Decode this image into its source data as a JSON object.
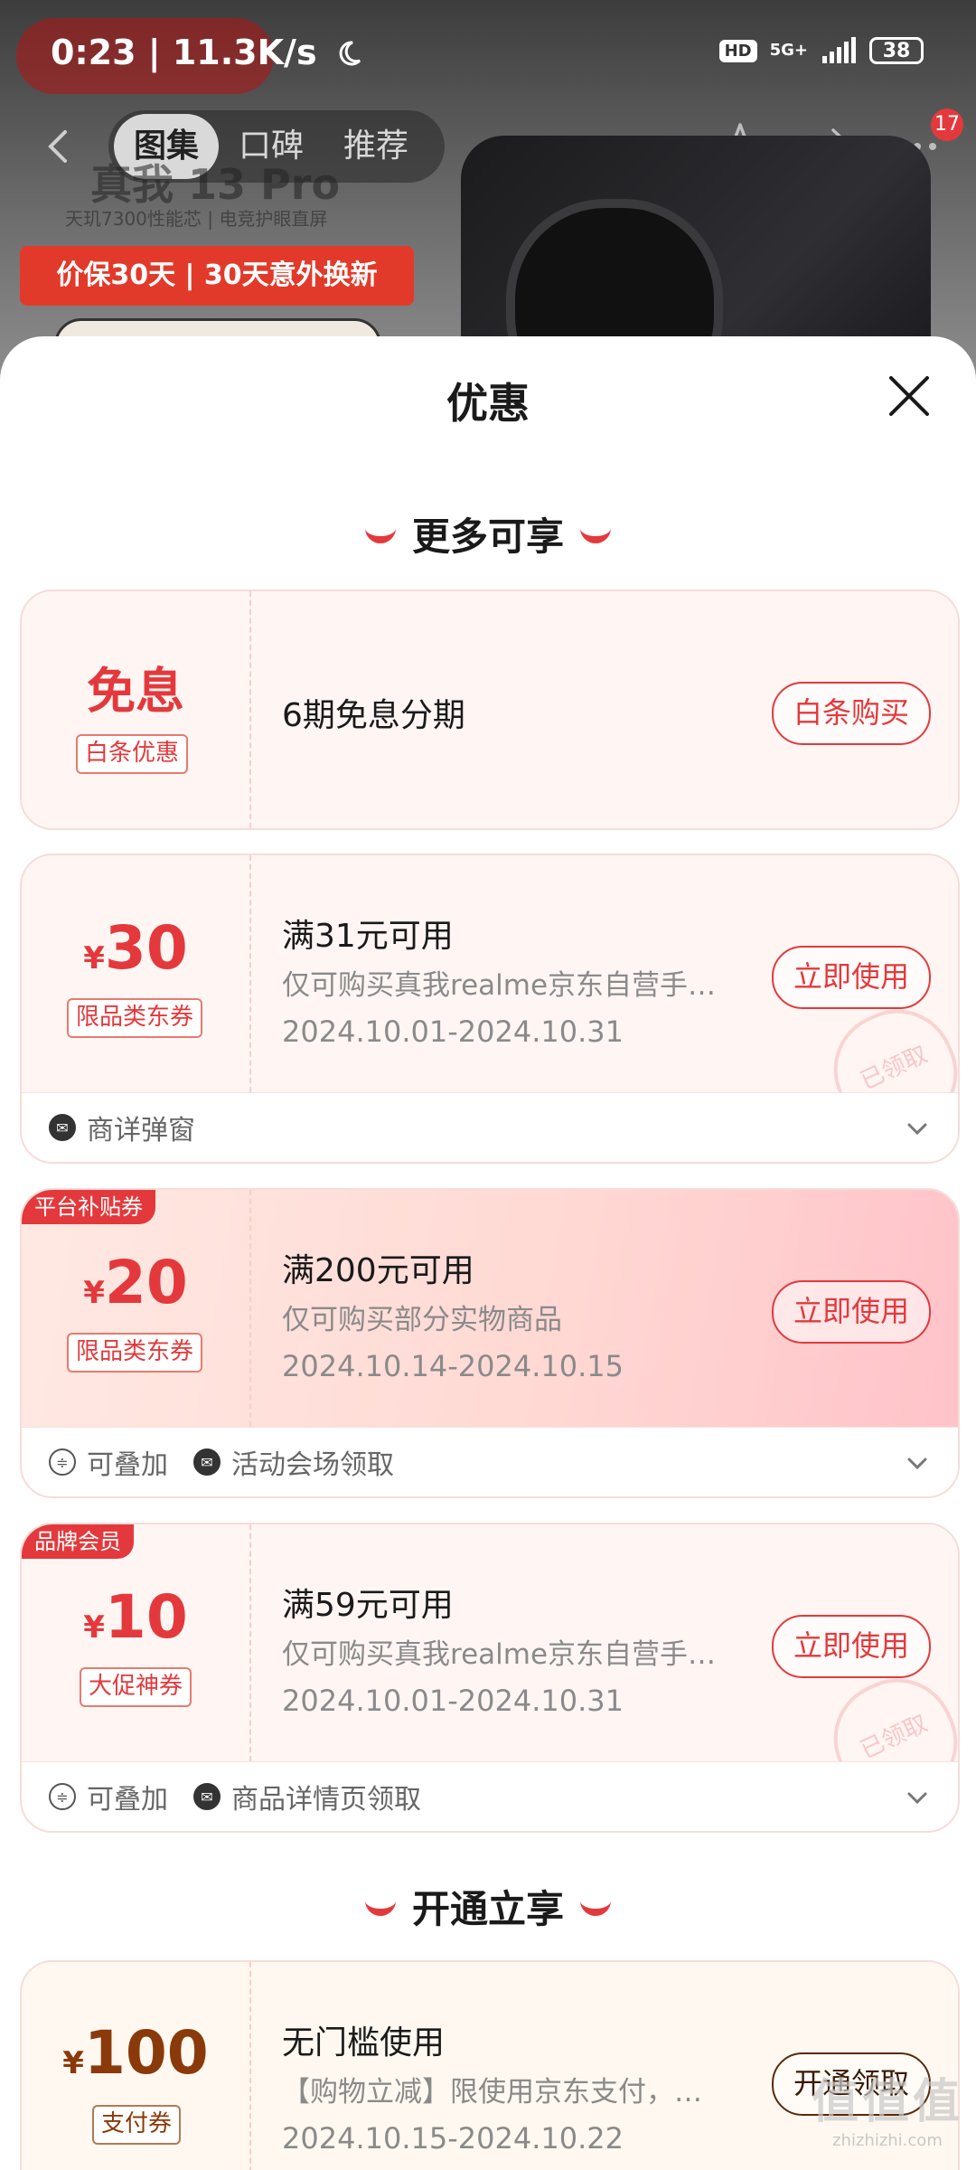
{
  "status_bar": {
    "time_speed": "0:23 | 11.3K/s",
    "hd": "HD",
    "network": "5G+",
    "battery": "38"
  },
  "product_nav": {
    "tabs": [
      "图集",
      "口碑",
      "推荐"
    ],
    "active_tab": 0,
    "notification_count": "17"
  },
  "product_promo": {
    "title": "真我 13 Pro",
    "subtitle": "天玑7300性能芯 | 电竞护眼直屏",
    "banner": "价保30天 | 30天意外换新"
  },
  "sheet": {
    "title": "优惠",
    "section1": "更多可享",
    "section2": "开通立享"
  },
  "cards": [
    {
      "big_text": "免息",
      "tag": "白条优惠",
      "title": "6期免息分期",
      "button": "白条购买"
    },
    {
      "yen": "¥",
      "amount": "30",
      "tag": "限品类东券",
      "title": "满31元可用",
      "desc": "仅可购买真我realme京东自营手…",
      "date": "2024.10.01-2024.10.31",
      "button": "立即使用",
      "stamp": "已领取",
      "footer": [
        "商详弹窗"
      ]
    },
    {
      "ribbon": "平台补贴券",
      "yen": "¥",
      "amount": "20",
      "tag": "限品类东券",
      "title": "满200元可用",
      "desc": "仅可购买部分实物商品",
      "date": "2024.10.14-2024.10.15",
      "button": "立即使用",
      "footer": [
        "可叠加",
        "活动会场领取"
      ]
    },
    {
      "ribbon": "品牌会员",
      "yen": "¥",
      "amount": "10",
      "tag": "大促神券",
      "title": "满59元可用",
      "desc": "仅可购买真我realme京东自营手…",
      "date": "2024.10.01-2024.10.31",
      "button": "立即使用",
      "stamp": "已领取",
      "footer": [
        "可叠加",
        "商品详情页领取"
      ]
    },
    {
      "yen": "¥",
      "amount": "100",
      "tag": "支付券",
      "title": "无门槛使用",
      "desc": "【购物立减】限使用京东支付，…",
      "date": "2024.10.15-2024.10.22",
      "button": "开通领取"
    }
  ],
  "watermark": {
    "main": "值值值",
    "url": "zhizhizhi.com"
  },
  "colors": {
    "accent": "#e4393c",
    "card_bg": "#fff6f4",
    "brown": "#8a3a0a"
  }
}
